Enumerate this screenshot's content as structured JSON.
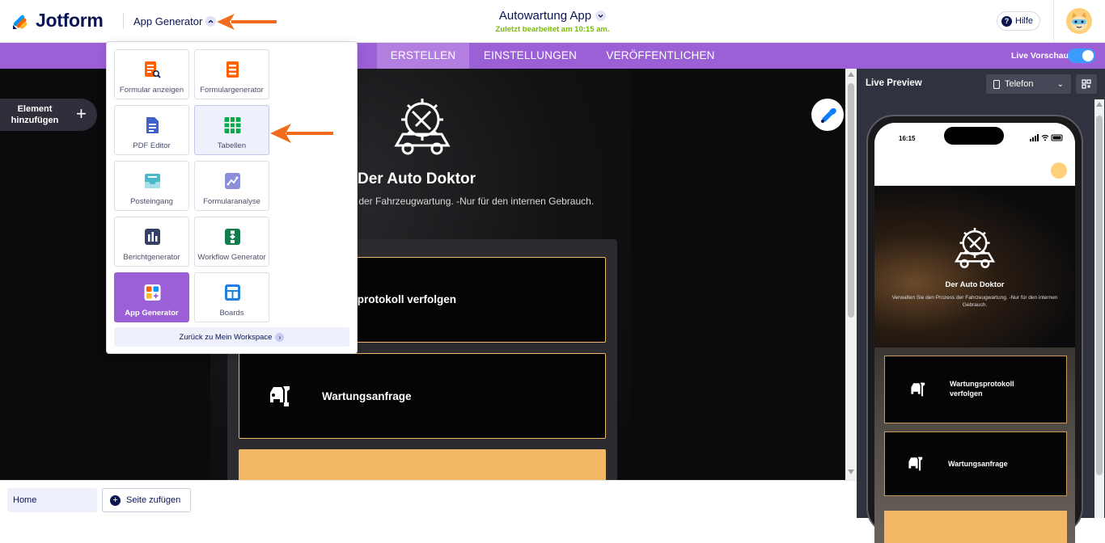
{
  "header": {
    "logo_text": "Jotform",
    "product_switcher_label": "App Generator",
    "app_title": "Autowartung App",
    "last_edited": "Zuletzt bearbeitet am 10:15 am.",
    "help_label": "Hilfe",
    "help_icon_glyph": "?"
  },
  "tabs": {
    "items": [
      {
        "label": "ERSTELLEN",
        "active": true
      },
      {
        "label": "EINSTELLUNGEN",
        "active": false
      },
      {
        "label": "VERÖFFENTLICHEN",
        "active": false
      }
    ],
    "live_toggle_label": "Live Vorschau",
    "live_toggle_on": true
  },
  "product_menu": {
    "items": [
      {
        "label": "Formular anzeigen",
        "icon": "form-view-icon",
        "state": "normal"
      },
      {
        "label": "Formulargenerator",
        "icon": "form-builder-icon",
        "state": "normal"
      },
      {
        "label": "PDF Editor",
        "icon": "pdf-icon",
        "state": "normal"
      },
      {
        "label": "Tabellen",
        "icon": "tables-icon",
        "state": "hover"
      },
      {
        "label": "Posteingang",
        "icon": "inbox-icon",
        "state": "normal"
      },
      {
        "label": "Formularanalyse",
        "icon": "analytics-icon",
        "state": "normal"
      },
      {
        "label": "Berichtgenerator",
        "icon": "report-icon",
        "state": "normal"
      },
      {
        "label": "Workflow Generator",
        "icon": "workflow-icon",
        "state": "normal"
      },
      {
        "label": "App Generator",
        "icon": "app-icon",
        "state": "active"
      },
      {
        "label": "Boards",
        "icon": "boards-icon",
        "state": "normal"
      }
    ],
    "back_to_workspace": "Zurück zu Mein Workspace",
    "back_chevron": "›"
  },
  "canvas": {
    "add_element_label": "Element hinzufügen",
    "add_element_plus": "+",
    "app_name": "Der Auto Doktor",
    "app_description_visible": "s der Fahrzeugwartung. -Nur für den internen Gebrauch.",
    "cards": [
      {
        "label_visible": "gsprotokoll verfolgen"
      },
      {
        "label": "Wartungsanfrage",
        "icon": "car-wrench-icon"
      }
    ]
  },
  "bottom": {
    "page_tab": "Home",
    "add_page_label": "Seite zufügen",
    "add_page_plus": "+"
  },
  "preview": {
    "title": "Live Preview",
    "device_label": "Telefon",
    "device_chevron": "⌄",
    "status_time": "16:15",
    "app_name": "Der Auto Doktor",
    "app_description": "Verwalten Sie den Prozess der Fahrzeugwartung. -Nur für den internen Gebrauch.",
    "cards": [
      {
        "label": "Wartungsprotokoll verfolgen"
      },
      {
        "label": "Wartungsanfrage"
      }
    ]
  },
  "colors": {
    "brand_navy": "#0a1551",
    "purple_bar": "#9c60d6",
    "active_tab": "#b27fe0",
    "edited_green": "#78bb07",
    "card_border": "#f1b967",
    "annotation_arrow": "#f26b1d"
  }
}
